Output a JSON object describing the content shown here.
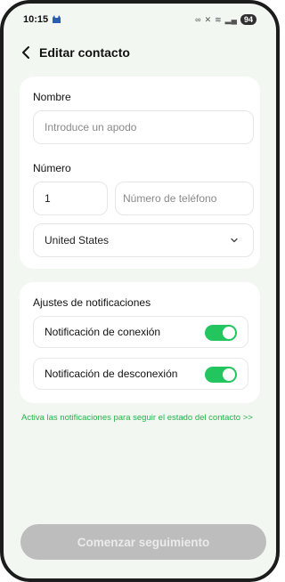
{
  "status_bar": {
    "time": "10:15",
    "app_icon": "cat-icon",
    "icons": [
      "link-icon",
      "mute-icon",
      "wifi-icon",
      "signal-icon"
    ],
    "battery": "94"
  },
  "header": {
    "back_icon": "chevron-left-icon",
    "title": "Editar contacto"
  },
  "form": {
    "name_label": "Nombre",
    "name_placeholder": "Introduce un apodo",
    "number_label": "Número",
    "country_code": "1",
    "phone_placeholder": "Número de teléfono",
    "country": "United States",
    "country_chevron_icon": "chevron-down-icon"
  },
  "notifications": {
    "title": "Ajustes de notificaciones",
    "connect_label": "Notificación de conexión",
    "connect_on": true,
    "disconnect_label": "Notificación de desconexión",
    "disconnect_on": true
  },
  "hint_text": "Activa las notificaciones para seguir el estado del contacto >>",
  "cta_label": "Comenzar seguimiento",
  "colors": {
    "accent": "#22c55e",
    "background": "#f2f7f2",
    "cta_disabled": "#bdbdbd"
  }
}
